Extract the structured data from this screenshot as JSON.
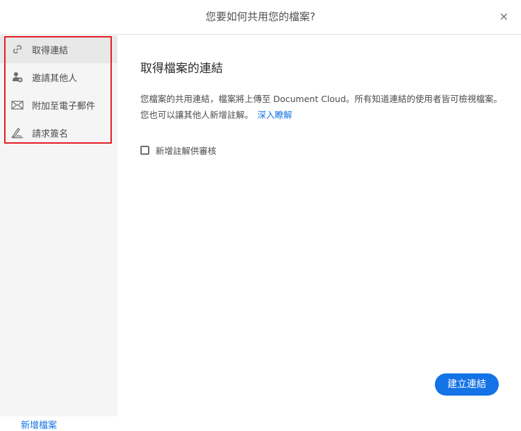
{
  "dialog": {
    "title": "您要如何共用您的檔案?",
    "close_label": "×"
  },
  "sidebar": {
    "items": [
      {
        "label": "取得連結",
        "icon": "link-icon",
        "selected": true
      },
      {
        "label": "邀請其他人",
        "icon": "add-person-icon"
      },
      {
        "label": "附加至電子郵件",
        "icon": "mail-icon"
      },
      {
        "label": "請求簽名",
        "icon": "sign-icon"
      }
    ],
    "new_file": "新增檔案"
  },
  "main": {
    "heading": "取得檔案的連結",
    "description": "您檔案的共用連結，檔案將上傳至 Document Cloud。所有知道連結的使用者皆可檢視檔案。您也可以讓其他人新增註解。",
    "learn_more": "深入瞭解",
    "checkbox_label": "新增註解供審核",
    "checkbox_checked": false,
    "create_button": "建立連結"
  },
  "colors": {
    "accent": "#1473e6",
    "highlight": "#e01e25"
  }
}
